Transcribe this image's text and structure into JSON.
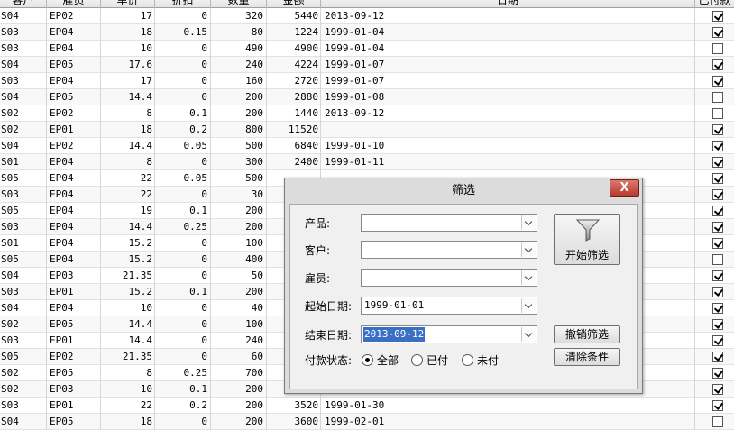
{
  "grid": {
    "columns": [
      "客户",
      "雇员",
      "单价",
      "折扣",
      "数量",
      "金额",
      "日期",
      "已付款"
    ],
    "rows": [
      {
        "customer": "S04",
        "employee": "EP02",
        "price": "17",
        "discount": "0",
        "qty": "320",
        "amount": "5440",
        "date": "2013-09-12",
        "paid": true
      },
      {
        "customer": "S03",
        "employee": "EP04",
        "price": "18",
        "discount": "0.15",
        "qty": "80",
        "amount": "1224",
        "date": "1999-01-04",
        "paid": true
      },
      {
        "customer": "S03",
        "employee": "EP04",
        "price": "10",
        "discount": "0",
        "qty": "490",
        "amount": "4900",
        "date": "1999-01-04",
        "paid": false
      },
      {
        "customer": "S04",
        "employee": "EP05",
        "price": "17.6",
        "discount": "0",
        "qty": "240",
        "amount": "4224",
        "date": "1999-01-07",
        "paid": true
      },
      {
        "customer": "S03",
        "employee": "EP04",
        "price": "17",
        "discount": "0",
        "qty": "160",
        "amount": "2720",
        "date": "1999-01-07",
        "paid": true
      },
      {
        "customer": "S04",
        "employee": "EP05",
        "price": "14.4",
        "discount": "0",
        "qty": "200",
        "amount": "2880",
        "date": "1999-01-08",
        "paid": false
      },
      {
        "customer": "S02",
        "employee": "EP02",
        "price": "8",
        "discount": "0.1",
        "qty": "200",
        "amount": "1440",
        "date": "2013-09-12",
        "paid": false
      },
      {
        "customer": "S02",
        "employee": "EP01",
        "price": "18",
        "discount": "0.2",
        "qty": "800",
        "amount": "11520",
        "date": "",
        "paid": true
      },
      {
        "customer": "S04",
        "employee": "EP02",
        "price": "14.4",
        "discount": "0.05",
        "qty": "500",
        "amount": "6840",
        "date": "1999-01-10",
        "paid": true
      },
      {
        "customer": "S01",
        "employee": "EP04",
        "price": "8",
        "discount": "0",
        "qty": "300",
        "amount": "2400",
        "date": "1999-01-11",
        "paid": true
      },
      {
        "customer": "S05",
        "employee": "EP04",
        "price": "22",
        "discount": "0.05",
        "qty": "500",
        "amount": "",
        "date": "",
        "paid": true
      },
      {
        "customer": "S03",
        "employee": "EP04",
        "price": "22",
        "discount": "0",
        "qty": "30",
        "amount": "",
        "date": "",
        "paid": true
      },
      {
        "customer": "S05",
        "employee": "EP04",
        "price": "19",
        "discount": "0.1",
        "qty": "200",
        "amount": "",
        "date": "",
        "paid": true
      },
      {
        "customer": "S03",
        "employee": "EP04",
        "price": "14.4",
        "discount": "0.25",
        "qty": "200",
        "amount": "",
        "date": "",
        "paid": true
      },
      {
        "customer": "S01",
        "employee": "EP04",
        "price": "15.2",
        "discount": "0",
        "qty": "100",
        "amount": "",
        "date": "",
        "paid": true
      },
      {
        "customer": "S05",
        "employee": "EP04",
        "price": "15.2",
        "discount": "0",
        "qty": "400",
        "amount": "",
        "date": "",
        "paid": false
      },
      {
        "customer": "S04",
        "employee": "EP03",
        "price": "21.35",
        "discount": "0",
        "qty": "50",
        "amount": "",
        "date": "",
        "paid": true
      },
      {
        "customer": "S03",
        "employee": "EP01",
        "price": "15.2",
        "discount": "0.1",
        "qty": "200",
        "amount": "",
        "date": "",
        "paid": true
      },
      {
        "customer": "S04",
        "employee": "EP04",
        "price": "10",
        "discount": "0",
        "qty": "40",
        "amount": "",
        "date": "",
        "paid": true
      },
      {
        "customer": "S02",
        "employee": "EP05",
        "price": "14.4",
        "discount": "0",
        "qty": "100",
        "amount": "",
        "date": "",
        "paid": true
      },
      {
        "customer": "S03",
        "employee": "EP01",
        "price": "14.4",
        "discount": "0",
        "qty": "240",
        "amount": "",
        "date": "",
        "paid": true
      },
      {
        "customer": "S05",
        "employee": "EP02",
        "price": "21.35",
        "discount": "0",
        "qty": "60",
        "amount": "",
        "date": "",
        "paid": true
      },
      {
        "customer": "S02",
        "employee": "EP05",
        "price": "8",
        "discount": "0.25",
        "qty": "700",
        "amount": "",
        "date": "",
        "paid": true
      },
      {
        "customer": "S02",
        "employee": "EP03",
        "price": "10",
        "discount": "0.1",
        "qty": "200",
        "amount": "",
        "date": "",
        "paid": true
      },
      {
        "customer": "S03",
        "employee": "EP01",
        "price": "22",
        "discount": "0.2",
        "qty": "200",
        "amount": "3520",
        "date": "1999-01-30",
        "paid": true
      },
      {
        "customer": "S04",
        "employee": "EP05",
        "price": "18",
        "discount": "0",
        "qty": "200",
        "amount": "3600",
        "date": "1999-02-01",
        "paid": false
      }
    ]
  },
  "dialog": {
    "title": "筛选",
    "close_label": "X",
    "product_label": "产品:",
    "product_value": "",
    "customer_label": "客户:",
    "customer_value": "",
    "employee_label": "雇员:",
    "employee_value": "",
    "start_date_label": "起始日期:",
    "start_date_value": "1999-01-01",
    "end_date_label": "结束日期:",
    "end_date_value": "2013-09-12",
    "payment_status_label": "付款状态:",
    "payment_options": [
      {
        "label": "全部",
        "selected": true
      },
      {
        "label": "已付",
        "selected": false
      },
      {
        "label": "未付",
        "selected": false
      }
    ],
    "start_filter_label": "开始筛选",
    "cancel_filter_label": "撤销筛选",
    "clear_conditions_label": "清除条件",
    "filter_icon": "funnel-icon"
  }
}
